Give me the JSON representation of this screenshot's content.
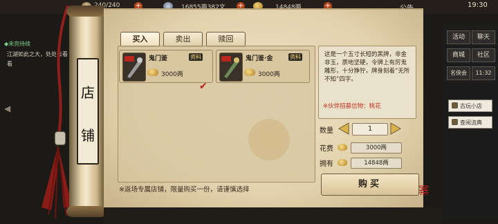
{
  "topbar": {
    "stamina": "240/240",
    "silver": "16855两382文",
    "gold": "14848两",
    "notice_label": "公告",
    "time": "19:30"
  },
  "quest": {
    "title": "◆未完待续",
    "desc": "江湖如此之大，处处去看看"
  },
  "side_menu": {
    "row1": [
      "活动",
      "聊天"
    ],
    "row2": [
      "商城",
      "社区"
    ],
    "row3": [
      "名侠会",
      "11:32"
    ],
    "wide1": "古玩小店",
    "wide2": "查阅流典"
  },
  "shop": {
    "title_chars": [
      "店",
      "铺"
    ],
    "tabs": [
      "买入",
      "卖出",
      "赎回"
    ],
    "active_tab": "买入",
    "items": [
      {
        "name": "鬼门鉴",
        "badge": "资料",
        "price": "3000两",
        "selected": true
      },
      {
        "name": "鬼门鉴·金",
        "badge": "资料",
        "price": "3000两",
        "selected": false
      }
    ],
    "footer_note": "※返场专属店铺，限量购买一份，请谨慎选择"
  },
  "detail": {
    "description": "这是一个五寸长短的黑牌，非金非玉，质地坚硬，令牌上有厉鬼雕形，十分狰狞，牌身刻着“无所不知”四字。",
    "recruit_note": "※伙伴招募信物：桃花",
    "quantity_label": "数量",
    "quantity": "1",
    "cost_label": "花费",
    "cost": "3000两",
    "own_label": "拥有",
    "own": "14848两",
    "buy_label": "购买"
  },
  "colors": {
    "accent_red": "#c0301f",
    "check_red": "#b51f1f",
    "parchment": "#e2d2ad",
    "gold": "#f7dc8a",
    "quest_green": "#7ed08d"
  }
}
